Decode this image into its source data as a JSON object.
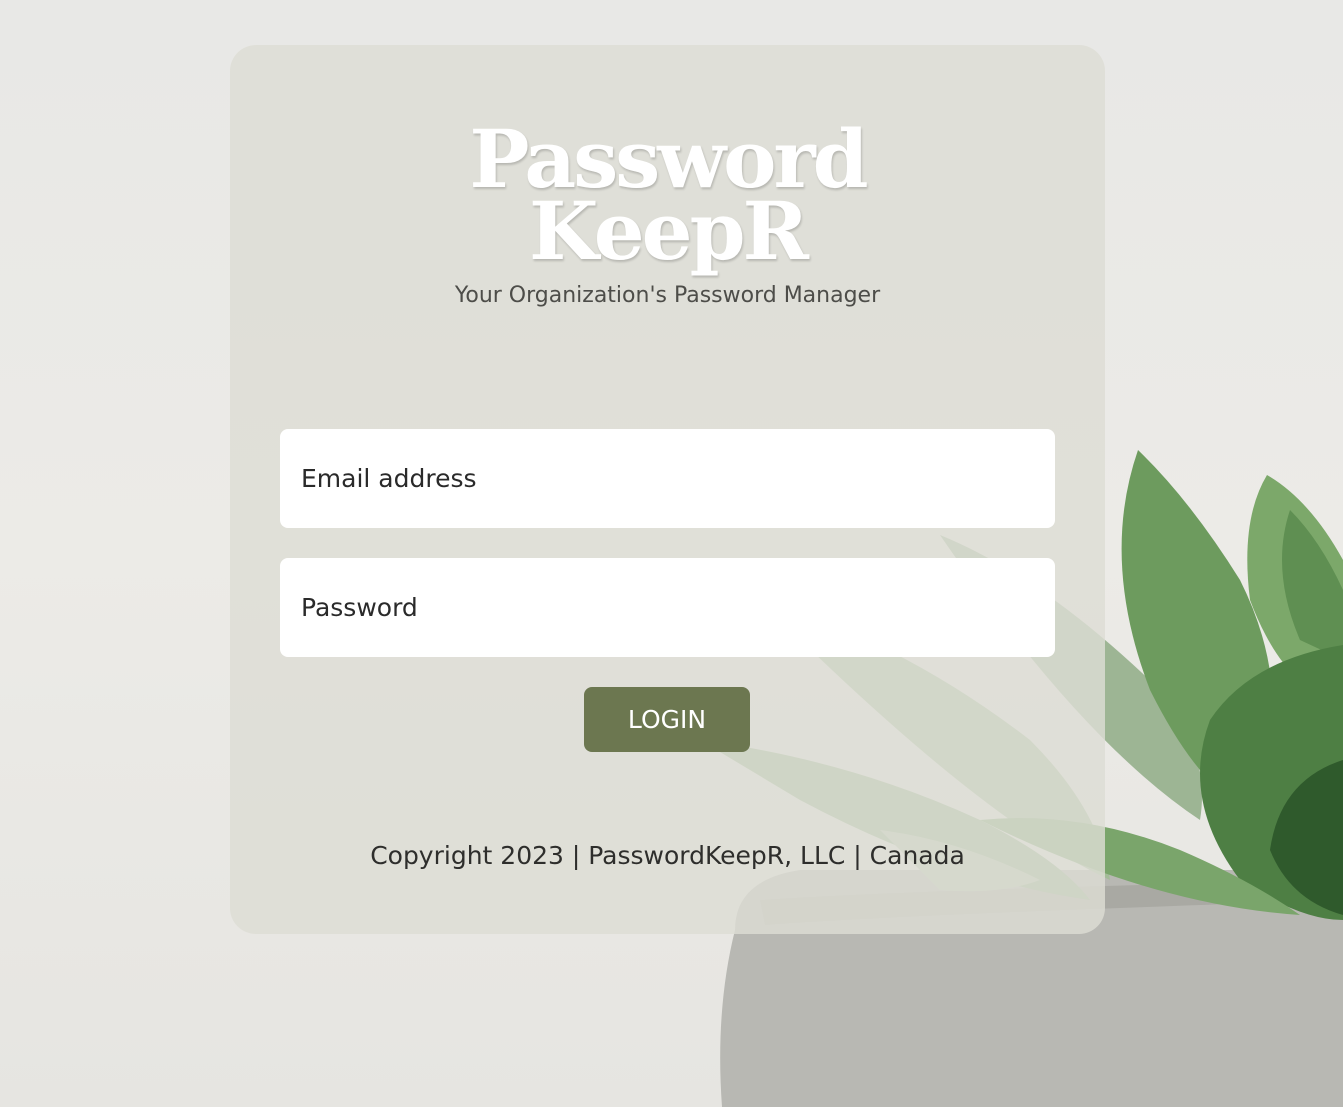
{
  "brand": {
    "logo_line1": "Password",
    "logo_line2": "KeepR",
    "tagline": "Your Organization's Password Manager"
  },
  "form": {
    "email_placeholder": "Email address",
    "password_placeholder": "Password",
    "login_label": "LOGIN"
  },
  "footer": {
    "copyright": "Copyright 2023 | PasswordKeepR, LLC | Canada"
  },
  "colors": {
    "accent": "#6c7750",
    "card_background": "#dddcd4",
    "page_background": "#e9e8e4"
  },
  "icons": {
    "background_decoration": "succulent-plant-in-concrete-pot"
  }
}
